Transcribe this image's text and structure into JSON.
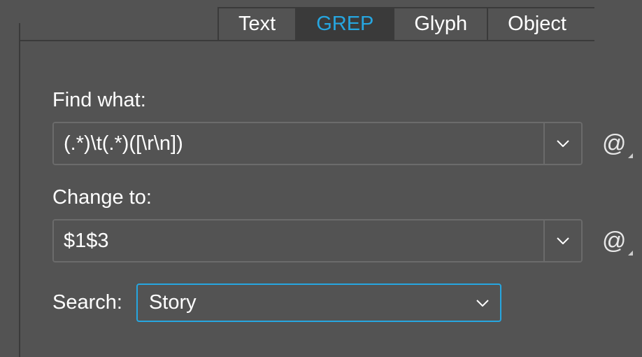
{
  "tabs": {
    "text": "Text",
    "grep": "GREP",
    "glyph": "Glyph",
    "object": "Object",
    "active": "grep"
  },
  "findWhat": {
    "label": "Find what:",
    "value": "(.*)\\t(.*)([\\r\\n])"
  },
  "changeTo": {
    "label": "Change to:",
    "value": "$1$3"
  },
  "search": {
    "label": "Search:",
    "value": "Story"
  },
  "specialChar": "@"
}
